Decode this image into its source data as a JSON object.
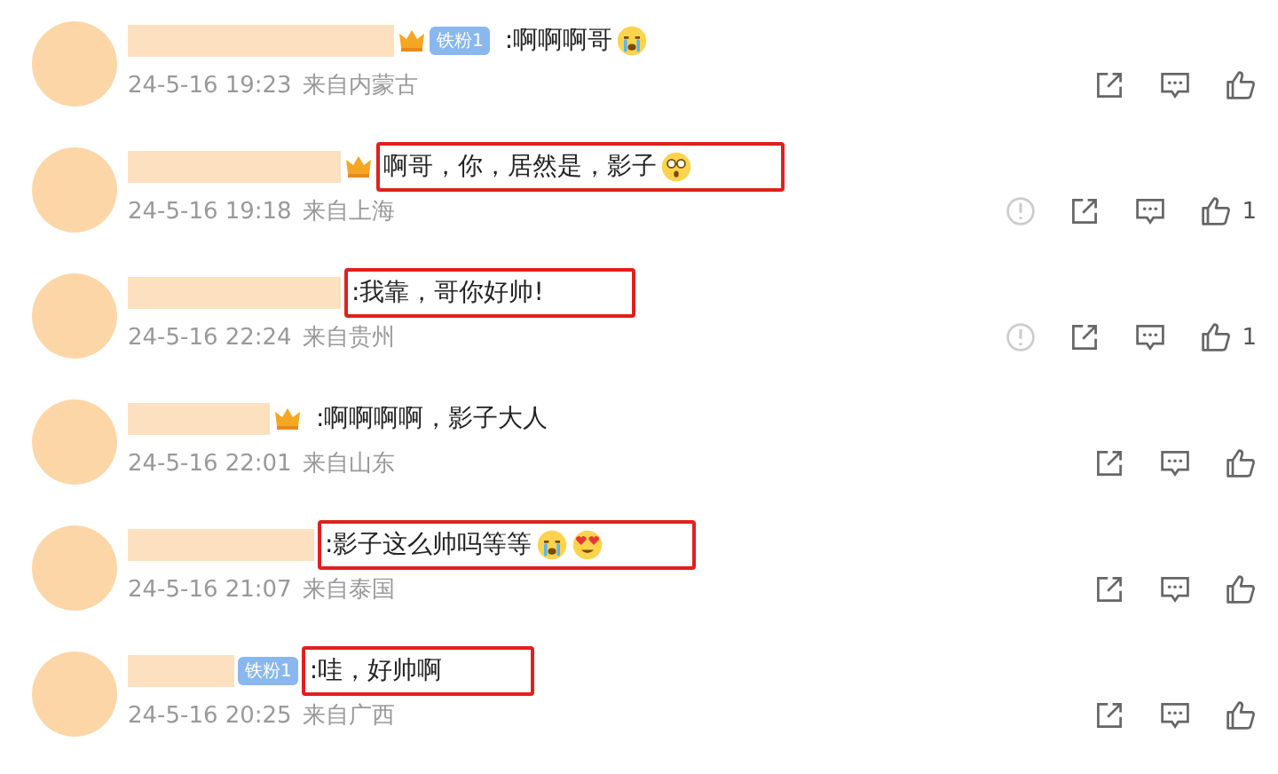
{
  "comments": [
    {
      "crown": true,
      "fan_badge": "铁粉1",
      "text": ":啊啊啊哥",
      "emojis": [
        {
          "kind": "crying"
        }
      ],
      "highlighted": false,
      "time": "24-5-16 19:23",
      "location": "来自内蒙古",
      "report": false
    },
    {
      "crown": true,
      "text": "啊哥，你，居然是，影子",
      "emojis": [
        {
          "kind": "surprised"
        }
      ],
      "highlighted": true,
      "time": "24-5-16 19:18",
      "location": "来自上海",
      "report": true,
      "likes": "1"
    },
    {
      "crown": false,
      "text": ":我靠，哥你好帅!",
      "highlighted": true,
      "time": "24-5-16 22:24",
      "location": "来自贵州",
      "report": true,
      "likes": "1"
    },
    {
      "crown": true,
      "text": ":啊啊啊啊，影子大人",
      "highlighted": false,
      "time": "24-5-16 22:01",
      "location": "来自山东",
      "report": false
    },
    {
      "crown": false,
      "text": ":影子这么帅吗等等",
      "emojis": [
        {
          "kind": "crying"
        },
        {
          "kind": "heart-eyes"
        }
      ],
      "highlighted": true,
      "time": "24-5-16 21:07",
      "location": "来自泰国",
      "report": false
    },
    {
      "crown": false,
      "fan_badge": "铁粉1",
      "text": ":哇，好帅啊",
      "highlighted": true,
      "time": "24-5-16 20:25",
      "location": "来自广西",
      "report": false
    }
  ]
}
